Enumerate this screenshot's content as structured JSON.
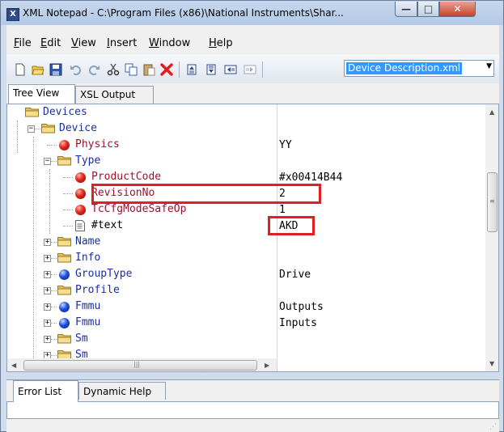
{
  "window": {
    "title": "XML Notepad - C:\\Program Files (x86)\\National Instruments\\Shar...",
    "app_icon_letter": "X",
    "min_glyph": "—",
    "max_glyph": "□",
    "close_glyph": "✕"
  },
  "menu": {
    "items": [
      {
        "mn": "F",
        "rest": "ile"
      },
      {
        "mn": "E",
        "rest": "dit"
      },
      {
        "mn": "V",
        "rest": "iew"
      },
      {
        "mn": "I",
        "rest": "nsert"
      },
      {
        "mn": "W",
        "rest": "indow"
      },
      {
        "mn": "H",
        "rest": "elp"
      }
    ]
  },
  "toolbar": {
    "icons": [
      "new-icon",
      "open-icon",
      "save-icon",
      "undo-icon",
      "redo-icon",
      "cut-icon",
      "copy-icon",
      "paste-icon",
      "delete-icon",
      "nudge-up-icon",
      "nudge-down-icon",
      "nudge-left-icon",
      "nudge-right-icon"
    ],
    "file_select": "Device Description.xml"
  },
  "tabs_top": [
    "Tree View",
    "XSL Output"
  ],
  "tree": [
    {
      "label": "Devices",
      "kind": "folder",
      "color": "blue",
      "value": ""
    },
    {
      "label": "Device",
      "kind": "folder",
      "color": "blue",
      "value": ""
    },
    {
      "label": "Physics",
      "kind": "attr",
      "color": "red",
      "value": "YY"
    },
    {
      "label": "Type",
      "kind": "folder",
      "color": "blue",
      "value": ""
    },
    {
      "label": "ProductCode",
      "kind": "attr",
      "color": "red",
      "value": "#x00414B44"
    },
    {
      "label": "RevisionNo",
      "kind": "attr",
      "color": "red",
      "value": "2"
    },
    {
      "label": "TcCfgModeSafeOp",
      "kind": "attr",
      "color": "red",
      "value": "1"
    },
    {
      "label": "#text",
      "kind": "text",
      "color": "black",
      "value": "AKD"
    },
    {
      "label": "Name",
      "kind": "folder",
      "color": "blue",
      "value": ""
    },
    {
      "label": "Info",
      "kind": "folder",
      "color": "blue",
      "value": ""
    },
    {
      "label": "GroupType",
      "kind": "elem",
      "color": "blue",
      "value": "Drive"
    },
    {
      "label": "Profile",
      "kind": "folder",
      "color": "blue",
      "value": ""
    },
    {
      "label": "Fmmu",
      "kind": "elem",
      "color": "blue",
      "value": "Outputs"
    },
    {
      "label": "Fmmu",
      "kind": "elem",
      "color": "blue",
      "value": "Inputs"
    },
    {
      "label": "Sm",
      "kind": "folder",
      "color": "blue",
      "value": ""
    },
    {
      "label": "Sm",
      "kind": "folder",
      "color": "blue",
      "value": ""
    }
  ],
  "tabs_bottom": [
    "Error List",
    "Dynamic Help"
  ],
  "colors": {
    "highlight_box": "#e02020",
    "node_blue": "#1c2fa0",
    "node_red": "#a0102c"
  }
}
